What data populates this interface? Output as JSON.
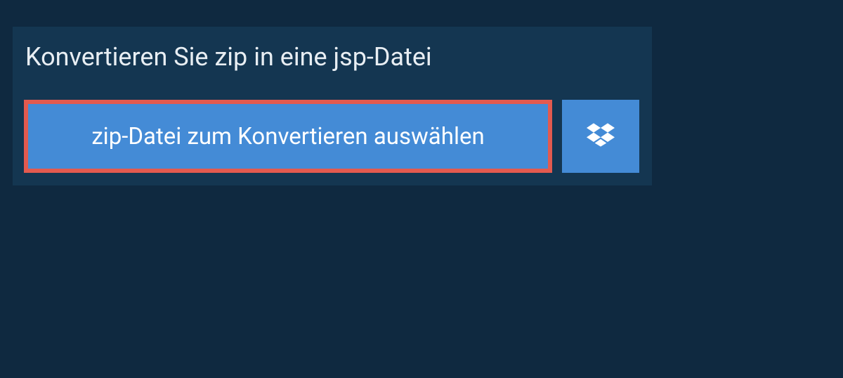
{
  "header": {
    "title": "Konvertieren Sie zip in eine jsp-Datei"
  },
  "actions": {
    "select_file_label": "zip-Datei zum Konvertieren auswählen",
    "dropbox_icon": "dropbox-icon"
  },
  "colors": {
    "background": "#0f2940",
    "panel": "#143651",
    "button": "#448bd6",
    "highlight_border": "#e35a4f",
    "text": "#ffffff"
  }
}
